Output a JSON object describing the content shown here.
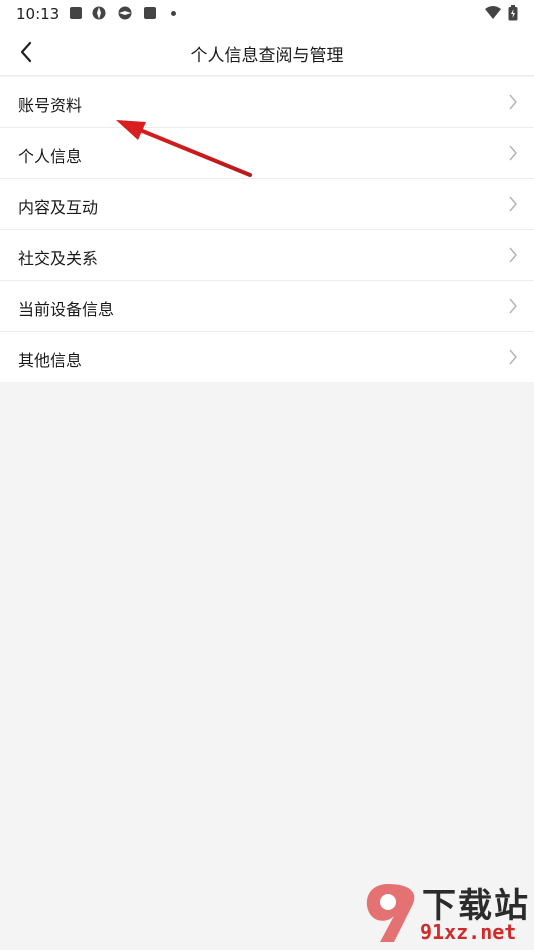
{
  "status_bar": {
    "time": "10:13"
  },
  "navbar": {
    "back_icon": "chevron-left-icon",
    "title": "个人信息查阅与管理"
  },
  "menu": {
    "items": [
      {
        "label": "账号资料"
      },
      {
        "label": "个人信息"
      },
      {
        "label": "内容及互动"
      },
      {
        "label": "社交及关系"
      },
      {
        "label": "当前设备信息"
      },
      {
        "label": "其他信息"
      }
    ]
  },
  "annotation": {
    "arrow_color": "#d81e1e"
  },
  "watermark": {
    "top_text": "下载站",
    "bottom_text": "91xz.net"
  },
  "colors": {
    "background": "#f4f4f4",
    "surface": "#ffffff",
    "divider": "#ececec",
    "chevron": "#b5b5b5"
  }
}
